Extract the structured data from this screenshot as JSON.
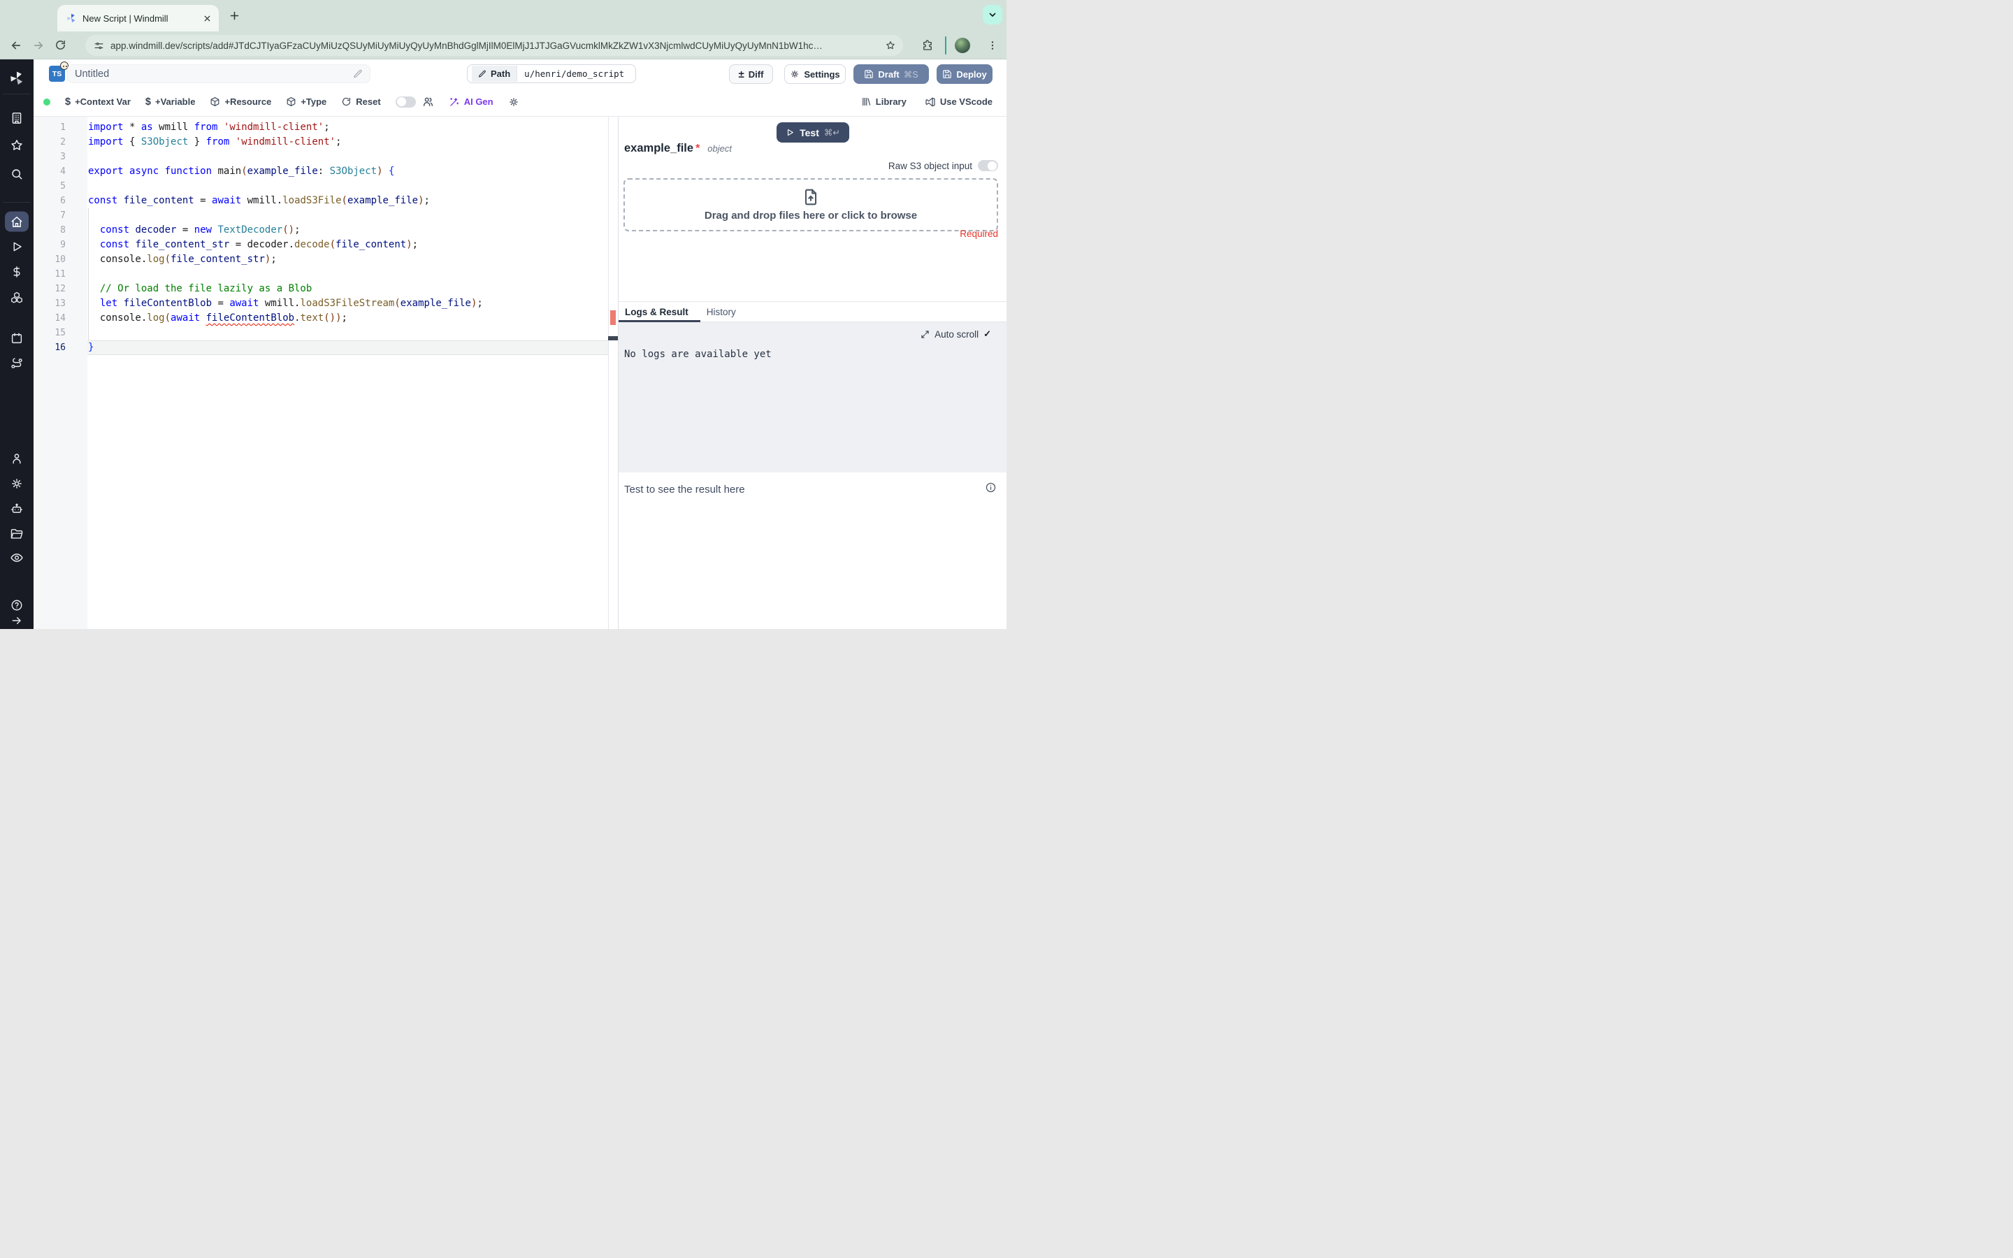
{
  "browser": {
    "tab_title": "New Script | Windmill",
    "url": "app.windmill.dev/scripts/add#JTdCJTIyaGFzaCUyMiUzQSUyMiUyMiUyQyUyMnBhdGglMjIlM0ElMjJ1JTJGaGVucmklMkZkZW1vX3NjcmlwdCUyMiUyQyUyMnN1bW1hc…"
  },
  "header": {
    "lang_badge": "TS",
    "script_title": "Untitled",
    "path_label": "Path",
    "path_value": "u/henri/demo_script",
    "diff_icon": "±",
    "diff_label": "Diff",
    "settings_label": "Settings",
    "draft_label": "Draft",
    "draft_shortcut": "⌘S",
    "deploy_label": "Deploy"
  },
  "toolbar": {
    "dollar_icon": "$",
    "context_var_label": "+Context Var",
    "variable_label": "+Variable",
    "resource_label": "+Resource",
    "type_label": "+Type",
    "reset_label": "Reset",
    "ai_gen_label": "AI Gen",
    "library_label": "Library",
    "vscode_label": "Use VScode"
  },
  "editor": {
    "active_line": 16,
    "error_line": 14,
    "lines": [
      [
        [
          "k",
          "import"
        ],
        [
          "p",
          " * "
        ],
        [
          "k",
          "as"
        ],
        [
          "p",
          " wmill "
        ],
        [
          "k",
          "from"
        ],
        [
          "p",
          " "
        ],
        [
          "s",
          "'windmill-client'"
        ],
        [
          "p",
          ";"
        ]
      ],
      [
        [
          "k",
          "import"
        ],
        [
          "p",
          " { "
        ],
        [
          "t",
          "S3Object"
        ],
        [
          "p",
          " } "
        ],
        [
          "k",
          "from"
        ],
        [
          "p",
          " "
        ],
        [
          "s",
          "'windmill-client'"
        ],
        [
          "p",
          ";"
        ]
      ],
      [],
      [
        [
          "k",
          "export"
        ],
        [
          "p",
          " "
        ],
        [
          "k",
          "async"
        ],
        [
          "p",
          " "
        ],
        [
          "k",
          "function"
        ],
        [
          "p",
          " main"
        ],
        [
          "b",
          "("
        ],
        [
          "v",
          "example_file"
        ],
        [
          "p",
          ": "
        ],
        [
          "t",
          "S3Object"
        ],
        [
          "b",
          ")"
        ],
        [
          "p",
          " "
        ],
        [
          "bb",
          "{"
        ]
      ],
      [],
      [
        [
          "k",
          "const"
        ],
        [
          "p",
          " "
        ],
        [
          "v",
          "file_content"
        ],
        [
          "p",
          " = "
        ],
        [
          "k",
          "await"
        ],
        [
          "p",
          " wmill."
        ],
        [
          "f",
          "loadS3File"
        ],
        [
          "b",
          "("
        ],
        [
          "v",
          "example_file"
        ],
        [
          "b",
          ")"
        ],
        [
          "p",
          ";"
        ]
      ],
      [],
      [
        [
          "p",
          "  "
        ],
        [
          "k",
          "const"
        ],
        [
          "p",
          " "
        ],
        [
          "v",
          "decoder"
        ],
        [
          "p",
          " = "
        ],
        [
          "k",
          "new"
        ],
        [
          "p",
          " "
        ],
        [
          "t",
          "TextDecoder"
        ],
        [
          "b",
          "()"
        ],
        [
          "p",
          ";"
        ]
      ],
      [
        [
          "p",
          "  "
        ],
        [
          "k",
          "const"
        ],
        [
          "p",
          " "
        ],
        [
          "v",
          "file_content_str"
        ],
        [
          "p",
          " = decoder."
        ],
        [
          "f",
          "decode"
        ],
        [
          "b",
          "("
        ],
        [
          "v",
          "file_content"
        ],
        [
          "b",
          ")"
        ],
        [
          "p",
          ";"
        ]
      ],
      [
        [
          "p",
          "  console."
        ],
        [
          "f",
          "log"
        ],
        [
          "b",
          "("
        ],
        [
          "v",
          "file_content_str"
        ],
        [
          "b",
          ")"
        ],
        [
          "p",
          ";"
        ]
      ],
      [],
      [
        [
          "p",
          "  "
        ],
        [
          "c",
          "// Or load the file lazily as a Blob"
        ]
      ],
      [
        [
          "p",
          "  "
        ],
        [
          "k",
          "let"
        ],
        [
          "p",
          " "
        ],
        [
          "v",
          "fileContentBlob"
        ],
        [
          "p",
          " = "
        ],
        [
          "k",
          "await"
        ],
        [
          "p",
          " wmill."
        ],
        [
          "f",
          "loadS3FileStream"
        ],
        [
          "b",
          "("
        ],
        [
          "v",
          "example_file"
        ],
        [
          "b",
          ")"
        ],
        [
          "p",
          ";"
        ]
      ],
      [
        [
          "p",
          "  console."
        ],
        [
          "f",
          "log"
        ],
        [
          "b",
          "("
        ],
        [
          "k",
          "await"
        ],
        [
          "p",
          " "
        ],
        [
          "v",
          "fileContentBlob",
          "sq"
        ],
        [
          "p",
          "."
        ],
        [
          "f",
          "text"
        ],
        [
          "b",
          "()"
        ],
        [
          "b",
          ")"
        ],
        [
          "p",
          ";"
        ]
      ],
      [],
      [
        [
          "bb",
          "}"
        ]
      ]
    ]
  },
  "panel": {
    "test_label": "Test",
    "test_shortcut": "⌘↵",
    "arg_name": "example_file",
    "required_star": "*",
    "arg_type": "object",
    "raw_s3_label": "Raw S3 object input",
    "dropzone_label": "Drag and drop files here or click to browse",
    "required_label": "Required",
    "tabs": [
      {
        "label": "Logs & Result"
      },
      {
        "label": "History"
      }
    ],
    "auto_scroll_label": "Auto scroll",
    "auto_scroll_check": "✓",
    "no_logs_text": "No logs are available yet",
    "result_placeholder": "Test to see the result here"
  },
  "colors": {
    "chrome_bg": "#d3e1da",
    "sidebar_bg": "#181b23",
    "primary_button": "#6b80a3",
    "test_button": "#3d4b67",
    "ai_accent": "#7c3aed",
    "required_red": "#e5342b",
    "error_marker": "#ee7b70",
    "typescript_blue": "#3178c6"
  }
}
